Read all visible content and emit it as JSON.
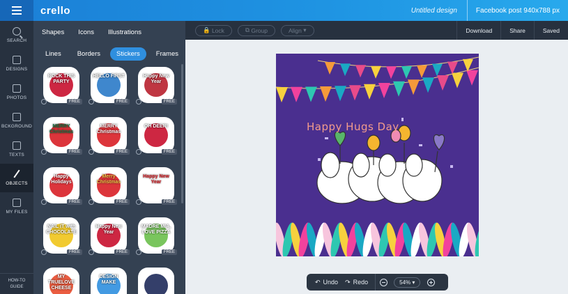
{
  "app": {
    "logo": "crello",
    "doc_title": "Untitled design",
    "doc_format": "Facebook post 940x788 px"
  },
  "nav": {
    "items": [
      {
        "label": "SEARCH",
        "icon": "search-icon"
      },
      {
        "label": "DESIGNS",
        "icon": "designs-icon"
      },
      {
        "label": "PHOTOS",
        "icon": "photos-icon"
      },
      {
        "label": "BCKGROUND",
        "icon": "background-icon"
      },
      {
        "label": "TEXTS",
        "icon": "texts-icon"
      },
      {
        "label": "OBJECTS",
        "icon": "objects-icon"
      },
      {
        "label": "MY FILES",
        "icon": "my-files-icon"
      }
    ],
    "howto_line1": "HOW-TO",
    "howto_line2": "GUIDE"
  },
  "panel": {
    "tabs_primary": [
      "Shapes",
      "Icons",
      "Illustrations"
    ],
    "tabs_secondary": [
      "Lines",
      "Borders",
      "Stickers",
      "Frames"
    ],
    "active_secondary": "Stickers",
    "free_badge": "FREE",
    "stickers": [
      {
        "text": "ROCK THIS PARTY",
        "color": "#ffffff",
        "accent": "#c8102e"
      },
      {
        "text": "HELLO FIRST",
        "color": "#ffffff",
        "accent": "#2a7ac8"
      },
      {
        "text": "Happy New Year",
        "color": "#ffffff",
        "accent": "#b8202e"
      },
      {
        "text": "MERRY Christmas",
        "color": "#1e7a4a",
        "accent": "#d81f26"
      },
      {
        "text": "MERRY Christmas",
        "color": "#ffffff",
        "accent": "#d81f26"
      },
      {
        "text": "OH DEER!",
        "color": "#ffffff",
        "accent": "#c8102e"
      },
      {
        "text": "Happy Holidays",
        "color": "#ffffff",
        "accent": "#d81f26"
      },
      {
        "text": "Merry Christmas",
        "color": "#f5c84a",
        "accent": "#d81f26"
      },
      {
        "text": "Happy New Year",
        "color": "#d81f26",
        "accent": "#ffffff"
      },
      {
        "text": "NAIL IT with CHOCOLATE",
        "color": "#ffffff",
        "accent": "#f0c419"
      },
      {
        "text": "Happy New Year",
        "color": "#ffffff",
        "accent": "#c8102e"
      },
      {
        "text": "MADRE MIA, LOVE PIZZA",
        "color": "#ffffff",
        "accent": "#6abf4b"
      },
      {
        "text": "MY TRUELOVE CHEESE",
        "color": "#ffffff",
        "accent": "#e84b2c"
      },
      {
        "text": "DESIGN MAKE",
        "color": "#ffffff",
        "accent": "#2f8fdf"
      },
      {
        "text": "",
        "color": "#ffffff",
        "accent": "#1e2a5a"
      }
    ]
  },
  "toolbar": {
    "lock": "Lock",
    "group": "Group",
    "align": "Align",
    "download": "Download",
    "share": "Share",
    "saved": "Saved"
  },
  "artboard": {
    "title": "Happy Hugs Day",
    "bg": "#4a2f8f",
    "bunting_colors": [
      "#f7d13e",
      "#f2429d",
      "#2ec7b1",
      "#f59a3a",
      "#1aa9c4",
      "#e84b8a"
    ]
  },
  "controls": {
    "undo": "Undo",
    "redo": "Redo",
    "zoom": "54%"
  }
}
